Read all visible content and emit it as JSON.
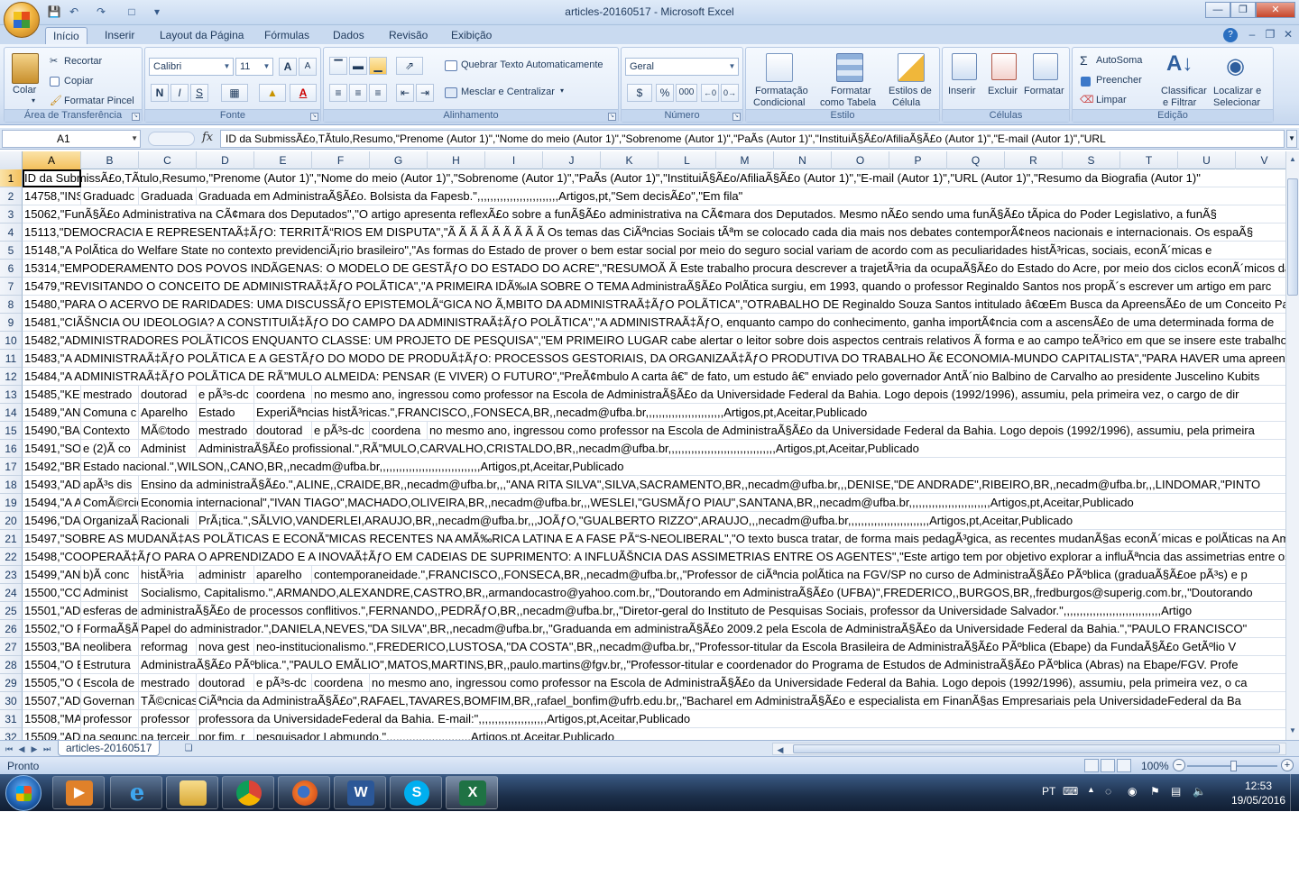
{
  "window": {
    "title": "articles-20160517 - Microsoft Excel"
  },
  "ribbon_tabs": [
    "Início",
    "Inserir",
    "Layout da Página",
    "Fórmulas",
    "Dados",
    "Revisão",
    "Exibição"
  ],
  "ribbon": {
    "clipboard": {
      "paste": "Colar",
      "cut": "Recortar",
      "copy": "Copiar",
      "format_painter": "Formatar Pincel",
      "label": "Área de Transferência"
    },
    "font": {
      "name": "Calibri",
      "size": "11",
      "label": "Fonte",
      "bold": "N",
      "italic": "I",
      "underline": "S",
      "grow": "A",
      "shrink": "A"
    },
    "alignment": {
      "wrap": "Quebrar Texto Automaticamente",
      "merge": "Mesclar e Centralizar",
      "label": "Alinhamento"
    },
    "number": {
      "format": "Geral",
      "percent": "%",
      "thousands": "000",
      "label": "Número"
    },
    "styles": {
      "conditional_1": "Formatação",
      "conditional_2": "Condicional",
      "as_table_1": "Formatar",
      "as_table_2": "como Tabela",
      "cell_styles_1": "Estilos de",
      "cell_styles_2": "Célula",
      "label": "Estilo"
    },
    "cells": {
      "insert": "Inserir",
      "delete": "Excluir",
      "format": "Formatar",
      "label": "Células"
    },
    "editing": {
      "autosum": "AutoSoma",
      "fill": "Preencher",
      "clear": "Limpar",
      "sort_1": "Classificar",
      "sort_2": "e Filtrar",
      "find_1": "Localizar e",
      "find_2": "Selecionar",
      "label": "Edição"
    }
  },
  "formula_bar": {
    "name_box": "A1",
    "fx": "fx",
    "content": "ID da SubmissÃ£o,TÃ­tulo,Resumo,\"Prenome (Autor 1)\",\"Nome do meio (Autor 1)\",\"Sobrenome (Autor 1)\",\"PaÃ­s (Autor 1)\",\"InstituiÃ§Ã£o/AfiliaÃ§Ã£o (Autor 1)\",\"E-mail (Autor 1)\",\"URL"
  },
  "columns": [
    "A",
    "B",
    "C",
    "D",
    "E",
    "F",
    "G",
    "H",
    "I",
    "J",
    "K",
    "L",
    "M",
    "N",
    "O",
    "P",
    "Q",
    "R",
    "S",
    "T",
    "U",
    "V"
  ],
  "rows": [
    {
      "n": "1",
      "cells": [
        "ID da SubmissÃ£o,TÃ­tulo,Resumo,\"Prenome (Autor 1)\",\"Nome do meio (Autor 1)\",\"Sobrenome (Autor 1)\",\"PaÃ­s (Autor 1)\",\"InstituiÃ§Ã£o/AfiliaÃ§Ã£o (Autor 1)\",\"E-mail (Autor 1)\",\"URL (Autor 1)\",\"Resumo da Biografia (Autor 1)\""
      ]
    },
    {
      "n": "2",
      "cells": [
        "14758,\"INSTITUCIONALIZAÃ‡ÃƒO",
        "Graduadc",
        "Graduada",
        "Graduada em AdministraÃ§Ã£o. Bolsista da Fapesb.\",,,,,,,,,,,,,,,,,,,,,,,,,Artigos,pt,\"Sem decisÃ£o\",\"Em fila\""
      ]
    },
    {
      "n": "3",
      "cells": [
        "15062,\"FunÃ§Ã£o Administrativa na CÃ¢mara dos Deputados\",\"O artigo apresenta reflexÃ£o sobre a funÃ§Ã£o administrativa na CÃ¢mara dos Deputados. Mesmo nÃ£o sendo uma funÃ§Ã£o tÃ­pica do Poder Legislativo, a funÃ§"
      ]
    },
    {
      "n": "4",
      "cells": [
        "15113,\"DEMOCRACIA E REPRESENTAÃ‡ÃƒO: TERRITÃ“RIOS EM DISPUTA\",\"Ã Ã Ã Ã Ã Ã Ã Ã Ã  Os temas das CiÃªncias Sociais tÃªm se colocado cada dia mais nos debates contemporÃ¢neos nacionais e internacionais. Os espaÃ§"
      ]
    },
    {
      "n": "5",
      "cells": [
        "15148,\"A PolÃ­tica do Welfare State no contexto previdenciÃ¡rio brasileiro\",\"As formas do Estado de prover o bem estar social por meio do seguro social variam de acordo com as peculiaridades histÃ³ricas, sociais, econÃ´micas e"
      ]
    },
    {
      "n": "6",
      "cells": [
        "15314,\"EMPODERAMENTO DOS POVOS INDÃGENAS: O MODELO DE GESTÃƒO DO ESTADO DO ACRE\",\"RESUMOÃ Ã Este trabalho procura descrever a trajetÃ³ria da ocupaÃ§Ã£o do Estado do Acre, por meio dos ciclos econÃ´micos da"
      ]
    },
    {
      "n": "7",
      "cells": [
        "15479,\"REVISITANDO O CONCEITO DE ADMINISTRAÃ‡ÃƒO POLÃTICA\",\"A PRIMEIRA IDÃ‰IA SOBRE O TEMA AdministraÃ§Ã£o PolÃ­tica surgiu, em 1993, quando o professor Reginaldo Santos nos propÃ´s escrever um artigo em parc"
      ]
    },
    {
      "n": "8",
      "cells": [
        "15480,\"PARA O ACERVO DE RARIDADES: UMA DISCUSSÃƒO EPISTEMOLÃ“GICA NO Ã‚MBITO DA ADMINISTRAÃ‡ÃƒO POLÃTICA\",\"OTRABALHO DE Reginaldo Souza Santos intitulado â€œEm Busca da ApreensÃ£o de um Conceito Para a"
      ]
    },
    {
      "n": "9",
      "cells": [
        "15481,\"CIÃŠNCIA OU IDEOLOGIA? A CONSTITUIÃ‡ÃƒO DO CAMPO DA ADMINISTRAÃ‡ÃƒO POLÃTICA\",\"A ADMINISTRAÃ‡ÃƒO, enquanto campo do conhecimento, ganha importÃ¢ncia com a ascensÃ£o de uma determinada forma de"
      ]
    },
    {
      "n": "10",
      "cells": [
        "15482,\"ADMINISTRADORES POLÃTICOS ENQUANTO CLASSE: UM PROJETO DE PESQUISA\",\"EM PRIMEIRO LUGAR cabe alertar o leitor sobre dois aspectos centrais relativos Ã  forma e ao campo teÃ³rico em que se insere este trabalho"
      ]
    },
    {
      "n": "11",
      "cells": [
        "15483,\"A ADMINISTRAÃ‡ÃƒO POLÃTICA E A GESTÃƒO DO MODO DE PRODUÃ‡ÃƒO: PROCESSOS GESTORIAIS, DA ORGANIZAÃ‡ÃƒO PRODUTIVA DO TRABALHO Ã€ ECONOMIA-MUNDO CAPITALISTA\",\"PARA HAVER uma apreensÃ£o inic"
      ]
    },
    {
      "n": "12",
      "cells": [
        "15484,\"A ADMINISTRAÃ‡ÃƒO POLÃTICA DE RÃ”MULO ALMEIDA: PENSAR (E VIVER) O FUTURO\",\"PreÃ¢mbulo A carta â€” de fato, um estudo â€” enviado pelo governador AntÃ´nio Balbino de Carvalho ao presidente Juscelino Kubits"
      ]
    },
    {
      "n": "13",
      "cells": [
        "15485,\"KEYNES",
        "mestrado",
        "doutorad",
        "e pÃ³s-dc",
        "coordena",
        "no mesmo ano, ingressou como professor na Escola de AdministraÃ§Ã£o da Universidade Federal da Bahia. Logo depois (1992/1996), assumiu, pela primeira vez, o cargo de dir"
      ]
    },
    {
      "n": "14",
      "cells": [
        "15489,\"ANÃLISE",
        "Comuna c",
        "Aparelho",
        "Estado",
        "ExperiÃªncias histÃ³ricas.\",FRANCISCO,,FONSECA,BR,,necadm@ufba.br,,,,,,,,,,,,,,,,,,,,,,,,Artigos,pt,Aceitar,Publicado"
      ]
    },
    {
      "n": "15",
      "cells": [
        "15490,\"BASES",
        "Contexto",
        "MÃ©todo",
        "mestrado",
        "doutorad",
        "e pÃ³s-dc",
        "coordena",
        "no mesmo ano, ingressou como professor na Escola de AdministraÃ§Ã£o da Universidade Federal da Bahia. Logo depois (1992/1996), assumiu, pela primeira"
      ]
    },
    {
      "n": "16",
      "cells": [
        "15491,\"SOCIEDADE",
        "e (2)Ã  co",
        "Administ",
        "AdministraÃ§Ã£o profissional.\",RÃ”MULO,CARVALHO,CRISTALDO,BR,,necadm@ufba.br,,,,,,,,,,,,,,,,,,,,,,,,,,,,,,,,,Artigos,pt,Aceitar,Publicado"
      ]
    },
    {
      "n": "17",
      "cells": [
        "15492,\"BRASIL",
        "Estado nacional.\",WILSON,,CANO,BR,,necadm@ufba.br,,,,,,,,,,,,,,,,,,,,,,,,,,,,,,,Artigos,pt,Aceitar,Publicado"
      ]
    },
    {
      "n": "18",
      "cells": [
        "15493,\"ADMINISTRAÃ‡ÃƒO",
        "apÃ³s dis",
        "Ensino da administraÃ§Ã£o.\",ALINE,,CRAIDE,BR,,necadm@ufba.br,,,\"ANA RITA SILVA\",SILVA,SACRAMENTO,BR,,necadm@ufba.br,,,DENISE,\"DE ANDRADE\",RIBEIRO,BR,,necadm@ufba.br,,,LINDOMAR,\"PINTO"
      ]
    },
    {
      "n": "19",
      "cells": [
        "15494,\"A ARTICULAÃ‡ÃƒO",
        "ComÃ©rcio",
        "Economia internacional\",\"IVAN TIAGO\",MACHADO,OLIVEIRA,BR,,necadm@ufba.br,,,WESLEI,\"GUSMÃƒO PIAU\",SANTANA,BR,,necadm@ufba.br,,,,,,,,,,,,,,,,,,,,,,,,,Artigos,pt,Aceitar,Publicado"
      ]
    },
    {
      "n": "20",
      "cells": [
        "15496,\"DA GESTÃƒO",
        "OrganizaÃ§Ã£o",
        "Racionali",
        "PrÃ¡tica.\",SÃLVIO,VANDERLEI,ARAUJO,BR,,necadm@ufba.br,,,JOÃƒO,\"GUALBERTO RIZZO\",ARAUJO,,,necadm@ufba.br,,,,,,,,,,,,,,,,,,,,,,,,,Artigos,pt,Aceitar,Publicado"
      ]
    },
    {
      "n": "21",
      "cells": [
        "15497,\"SOBRE AS MUDANÃ‡AS POLÃTICAS E ECONÃ”MICAS RECENTES NA AMÃ‰RICA LATINA E A FASE PÃ“S-NEOLIBERAL\",\"O texto busca tratar, de forma mais pedagÃ³gica, as recentes mudanÃ§as econÃ´micas e polÃ­ticas na Am"
      ]
    },
    {
      "n": "22",
      "cells": [
        "15498,\"COOPERAÃ‡ÃƒO PARA O APRENDIZADO E A INOVAÃ‡ÃƒO EM CADEIAS DE SUPRIMENTO: A INFLUÃŠNCIA DAS ASSIMETRIAS ENTRE OS AGENTES\",\"Este artigo tem por objetivo explorar a influÃªncia das assimetrias entre os el"
      ]
    },
    {
      "n": "23",
      "cells": [
        "15499,\"ANÃLISE",
        "b)Ã  conc",
        "histÃ³ria",
        "administr",
        "aparelho",
        "contemporaneidade.\",FRANCISCO,,FONSECA,BR,,necadm@ufba.br,,\"Professor de ciÃªncia polÃ­tica na FGV/SP no curso de AdministraÃ§Ã£o PÃºblica (graduaÃ§Ã£oe pÃ³s) e p"
      ]
    },
    {
      "n": "24",
      "cells": [
        "15500,\"COMO",
        "Administ",
        "Socialismo, Capitalismo.\",ARMANDO,ALEXANDRE,CASTRO,BR,,armandocastro@yahoo.com.br,,\"Doutorando em AdministraÃ§Ã£o (UFBA)\",FREDERICO,,BURGOS,BR,,fredburgos@superig.com.br,,\"Doutorando"
      ]
    },
    {
      "n": "25",
      "cells": [
        "15501,\"ADMINISTRAÃ‡ÃƒO",
        "esferas de",
        "administraÃ§Ã£o de processos conflitivos.\",FERNANDO,,PEDRÃƒO,BR,,necadm@ufba.br,,\"Diretor-geral do Instituto de Pesquisas Sociais, professor da Universidade Salvador.\",,,,,,,,,,,,,,,,,,,,,,,,,,,,,,Artigo"
      ]
    },
    {
      "n": "26",
      "cells": [
        "15502,\"O PAPEL",
        "FormaÃ§Ã£o",
        "Papel do administrador.\",DANIELA,NEVES,\"DA SILVA\",BR,,necadm@ufba.br,,\"Graduanda em administraÃ§Ã£o 2009.2 pela Escola de AdministraÃ§Ã£o da Universidade Federal da Bahia.\",\"PAULO FRANCISCO\""
      ]
    },
    {
      "n": "27",
      "cells": [
        "15503,\"BASES",
        "neolibera",
        "reformag",
        "nova gest",
        "neo-institucionalismo.\",FREDERICO,LUSTOSA,\"DA COSTA\",BR,,necadm@ufba.br,,\"Professor-titular da Escola Brasileira de AdministraÃ§Ã£o  PÃºblica (Ebape) da FundaÃ§Ã£o GetÃºlio V"
      ]
    },
    {
      "n": "28",
      "cells": [
        "15504,\"O ESTADO",
        "Estrutura",
        "AdministraÃ§Ã£o PÃºblica.\",\"PAULO EMÃLIO\",MATOS,MARTINS,BR,,paulo.martins@fgv.br,,\"Professor-titular e coordenador do Programa de Estudos de AdministraÃ§Ã£o PÃºblica (Abras) na Ebape/FGV. Profe"
      ]
    },
    {
      "n": "29",
      "cells": [
        "15505,\"O CICLO",
        "Escola de",
        "mestrado",
        "doutorad",
        "e pÃ³s-dc",
        "coordena",
        "no mesmo ano, ingressou como professor na Escola de AdministraÃ§Ã£o da Universidade Federal da Bahia. Logo depois (1992/1996), assumiu, pela primeira vez, o ca"
      ]
    },
    {
      "n": "30",
      "cells": [
        "15507,\"ADMINISTRAÃ‡ÃƒO",
        "Governan",
        "TÃ©cnicas",
        "CiÃªncia da AdministraÃ§Ã£o\",RAFAEL,TAVARES,BOMFIM,BR,,rafael_bonfim@ufrb.edu.br,,\"Bacharel em AdministraÃ§Ã£o e especialista em FinanÃ§as Empresariais pela UniversidadeFederal da Ba"
      ]
    },
    {
      "n": "31",
      "cells": [
        "15508,\"MANIFESTO",
        "professor",
        "professor",
        "professora da UniversidadeFederal da Bahia. E-mail:\",,,,,,,,,,,,,,,,,,,,,Artigos,pt,Aceitar,Publicado"
      ]
    },
    {
      "n": "32",
      "cells": [
        "15509,\"ADMINISTRAÃ‡ÃƒO",
        "na segunc",
        "na terceir",
        "por fim, r",
        "pesquisador Labmundo.\",,,,,,,,,,,,,,,,,,,,,,,,,,Artigos,pt,Aceitar,Publicado"
      ]
    }
  ],
  "sheet_tab": "articles-20160517",
  "status": {
    "mode": "Pronto",
    "zoom": "100%"
  },
  "taskbar": {
    "lang": "PT",
    "time": "12:53",
    "date": "19/05/2016",
    "apps": [
      "media-player-icon",
      "internet-explorer-icon",
      "file-explorer-icon",
      "chrome-icon",
      "firefox-icon",
      "word-icon",
      "skype-icon",
      "excel-icon"
    ]
  }
}
